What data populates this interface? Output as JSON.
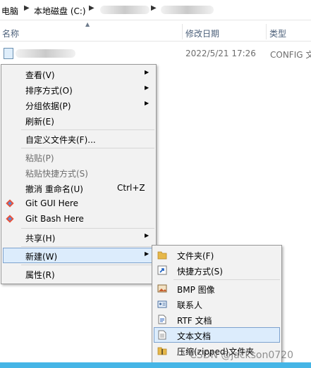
{
  "address": {
    "segments": [
      "电脑",
      "本地磁盘 (C:)"
    ]
  },
  "columns": {
    "name": "名称",
    "modified": "修改日期",
    "type": "类型"
  },
  "file_row": {
    "date": "2022/5/21 17:26",
    "type": "CONFIG 文"
  },
  "context_menu": [
    {
      "label": "查看(V)",
      "submenu": true
    },
    {
      "label": "排序方式(O)",
      "submenu": true
    },
    {
      "label": "分组依据(P)",
      "submenu": true
    },
    {
      "label": "刷新(E)"
    },
    {
      "label": "自定义文件夹(F)..."
    },
    {
      "label": "粘贴(P)",
      "disabled": true
    },
    {
      "label": "粘贴快捷方式(S)",
      "disabled": true
    },
    {
      "label": "撤消 重命名(U)",
      "shortcut": "Ctrl+Z"
    },
    {
      "label": "Git GUI Here"
    },
    {
      "label": "Git Bash Here"
    },
    {
      "label": "共享(H)",
      "submenu": true
    },
    {
      "label": "新建(W)",
      "submenu": true,
      "highlighted": true
    },
    {
      "label": "属性(R)"
    }
  ],
  "new_submenu": [
    {
      "label": "文件夹(F)",
      "icon": "folder-icon"
    },
    {
      "label": "快捷方式(S)",
      "icon": "shortcut-icon"
    },
    {
      "label": "BMP 图像",
      "icon": "bmp-image-icon"
    },
    {
      "label": "联系人",
      "icon": "contact-icon"
    },
    {
      "label": "RTF 文档",
      "icon": "rtf-document-icon"
    },
    {
      "label": "文本文档",
      "icon": "text-document-icon",
      "highlighted": true
    },
    {
      "label": "压缩(zipped)文件夹",
      "icon": "zip-folder-icon"
    }
  ],
  "watermark": "CSDN @jackson0720",
  "colors": {
    "highlight_bg": "#dcecfc",
    "highlight_border": "#7da2ce",
    "menu_bg": "#f2f2f2",
    "header_text": "#4c607a",
    "taskbar": "#45b5e6"
  }
}
